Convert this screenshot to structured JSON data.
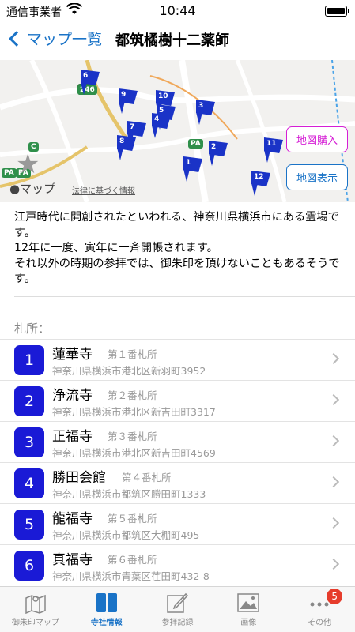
{
  "status_bar": {
    "carrier": "通信事業者",
    "time": "10:44"
  },
  "nav": {
    "back_label": "マップ一覧",
    "title": "都筑橘樹十二薬師"
  },
  "map": {
    "buy_button": "地図購入",
    "show_button": "地図表示",
    "attribution": "マップ",
    "legal_link": "法律に基づく情報",
    "route_label": "246",
    "flag_numbers": [
      "6",
      "9",
      "10",
      "5",
      "4",
      "3",
      "7",
      "8",
      "2",
      "1",
      "11",
      "12"
    ],
    "road_signs": [
      "C",
      "PA",
      "PA",
      "PA"
    ]
  },
  "description": [
    "江戸時代に開創されたといわれる、神奈川県横浜市にある霊場です。",
    "12年に一度、寅年に一斉開帳されます。",
    "それ以外の時期の参拝では、御朱印を頂けないこともあるそうです。"
  ],
  "section_label": "札所：",
  "temples": [
    {
      "no": "1",
      "name": "蓮華寺",
      "label": "第１番札所",
      "address": "神奈川県横浜市港北区新羽町3952"
    },
    {
      "no": "2",
      "name": "浄流寺",
      "label": "第２番札所",
      "address": "神奈川県横浜市港北区新吉田町3317"
    },
    {
      "no": "3",
      "name": "正福寺",
      "label": "第３番札所",
      "address": "神奈川県横浜市港北区新吉田町4569"
    },
    {
      "no": "4",
      "name": "勝田会館",
      "label": "第４番札所",
      "address": "神奈川県横浜市都筑区勝田町1333"
    },
    {
      "no": "5",
      "name": "龍福寺",
      "label": "第５番札所",
      "address": "神奈川県横浜市都筑区大棚町495"
    },
    {
      "no": "6",
      "name": "真福寺",
      "label": "第６番札所",
      "address": "神奈川県横浜市青葉区荏田町432-8"
    }
  ],
  "tabs": [
    {
      "label": "御朱印マップ",
      "icon": "map-icon"
    },
    {
      "label": "寺社情報",
      "icon": "book-icon"
    },
    {
      "label": "参拝記録",
      "icon": "pencil-icon"
    },
    {
      "label": "画像",
      "icon": "image-icon"
    },
    {
      "label": "その他",
      "icon": "more-icon",
      "badge": "5"
    }
  ],
  "colors": {
    "accent": "#1a73c7",
    "badge_blue": "#1a1ad6",
    "flag_blue": "#1a33c7",
    "buy_pink": "#d51ed5",
    "notif_red": "#e63c2c"
  }
}
